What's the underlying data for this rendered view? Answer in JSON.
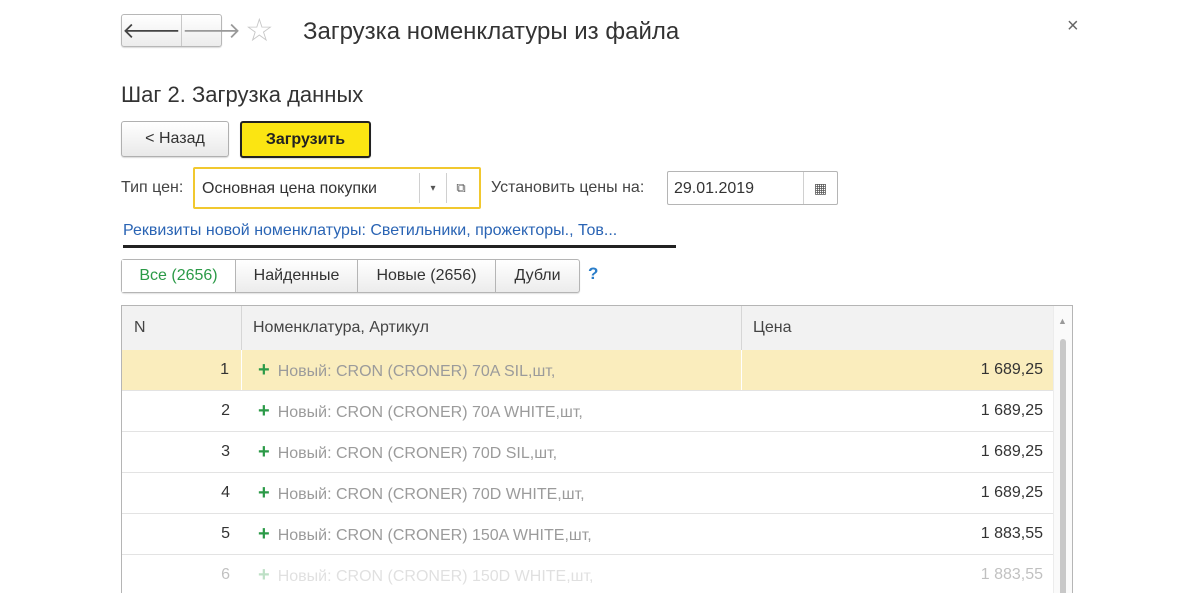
{
  "window": {
    "title": "Загрузка номенклатуры из файла",
    "close_glyph": "×",
    "nav_back_glyph": "🡐",
    "nav_forward_glyph": "🡒",
    "star_glyph": "☆"
  },
  "step_title": "Шаг 2. Загрузка данных",
  "buttons": {
    "back_label": "< Назад",
    "load_label": "Загрузить"
  },
  "price_type": {
    "label": "Тип цен:",
    "value": "Основная цена покупки",
    "dropdown_glyph": "▾",
    "open_glyph": "⧉"
  },
  "set_prices": {
    "label": "Установить цены на:",
    "value": "29.01.2019",
    "calendar_glyph": "▦"
  },
  "requisites_link": "Реквизиты новой номенклатуры: Светильники, прожекторы., Тов...",
  "filters": [
    {
      "label": "Все (2656)",
      "active": true
    },
    {
      "label": "Найденные",
      "active": false
    },
    {
      "label": "Новые (2656)",
      "active": false
    },
    {
      "label": "Дубли",
      "active": false
    }
  ],
  "help_label": "?",
  "table": {
    "headers": {
      "n": "N",
      "name": "Номенклатура, Артикул",
      "price": "Цена"
    },
    "plus_glyph": "+",
    "rows": [
      {
        "n": "1",
        "name": "Новый: CRON (CRONER) 70A SIL,шт,",
        "price": "1 689,25"
      },
      {
        "n": "2",
        "name": "Новый: CRON (CRONER) 70A WHITE,шт,",
        "price": "1 689,25"
      },
      {
        "n": "3",
        "name": "Новый: CRON (CRONER) 70D SIL,шт,",
        "price": "1 689,25"
      },
      {
        "n": "4",
        "name": "Новый: CRON (CRONER) 70D WHITE,шт,",
        "price": "1 689,25"
      },
      {
        "n": "5",
        "name": "Новый: CRON (CRONER) 150A WHITE,шт,",
        "price": "1 883,55"
      },
      {
        "n": "6",
        "name": "Новый: CRON (CRONER) 150D WHITE,шт,",
        "price": "1 883,55"
      }
    ],
    "scroll_up_glyph": "▲"
  },
  "colors": {
    "accent_yellow": "#fbe512",
    "selection_row": "#faedbd",
    "link_blue": "#2a64b4",
    "new_green": "#2b9a47"
  }
}
